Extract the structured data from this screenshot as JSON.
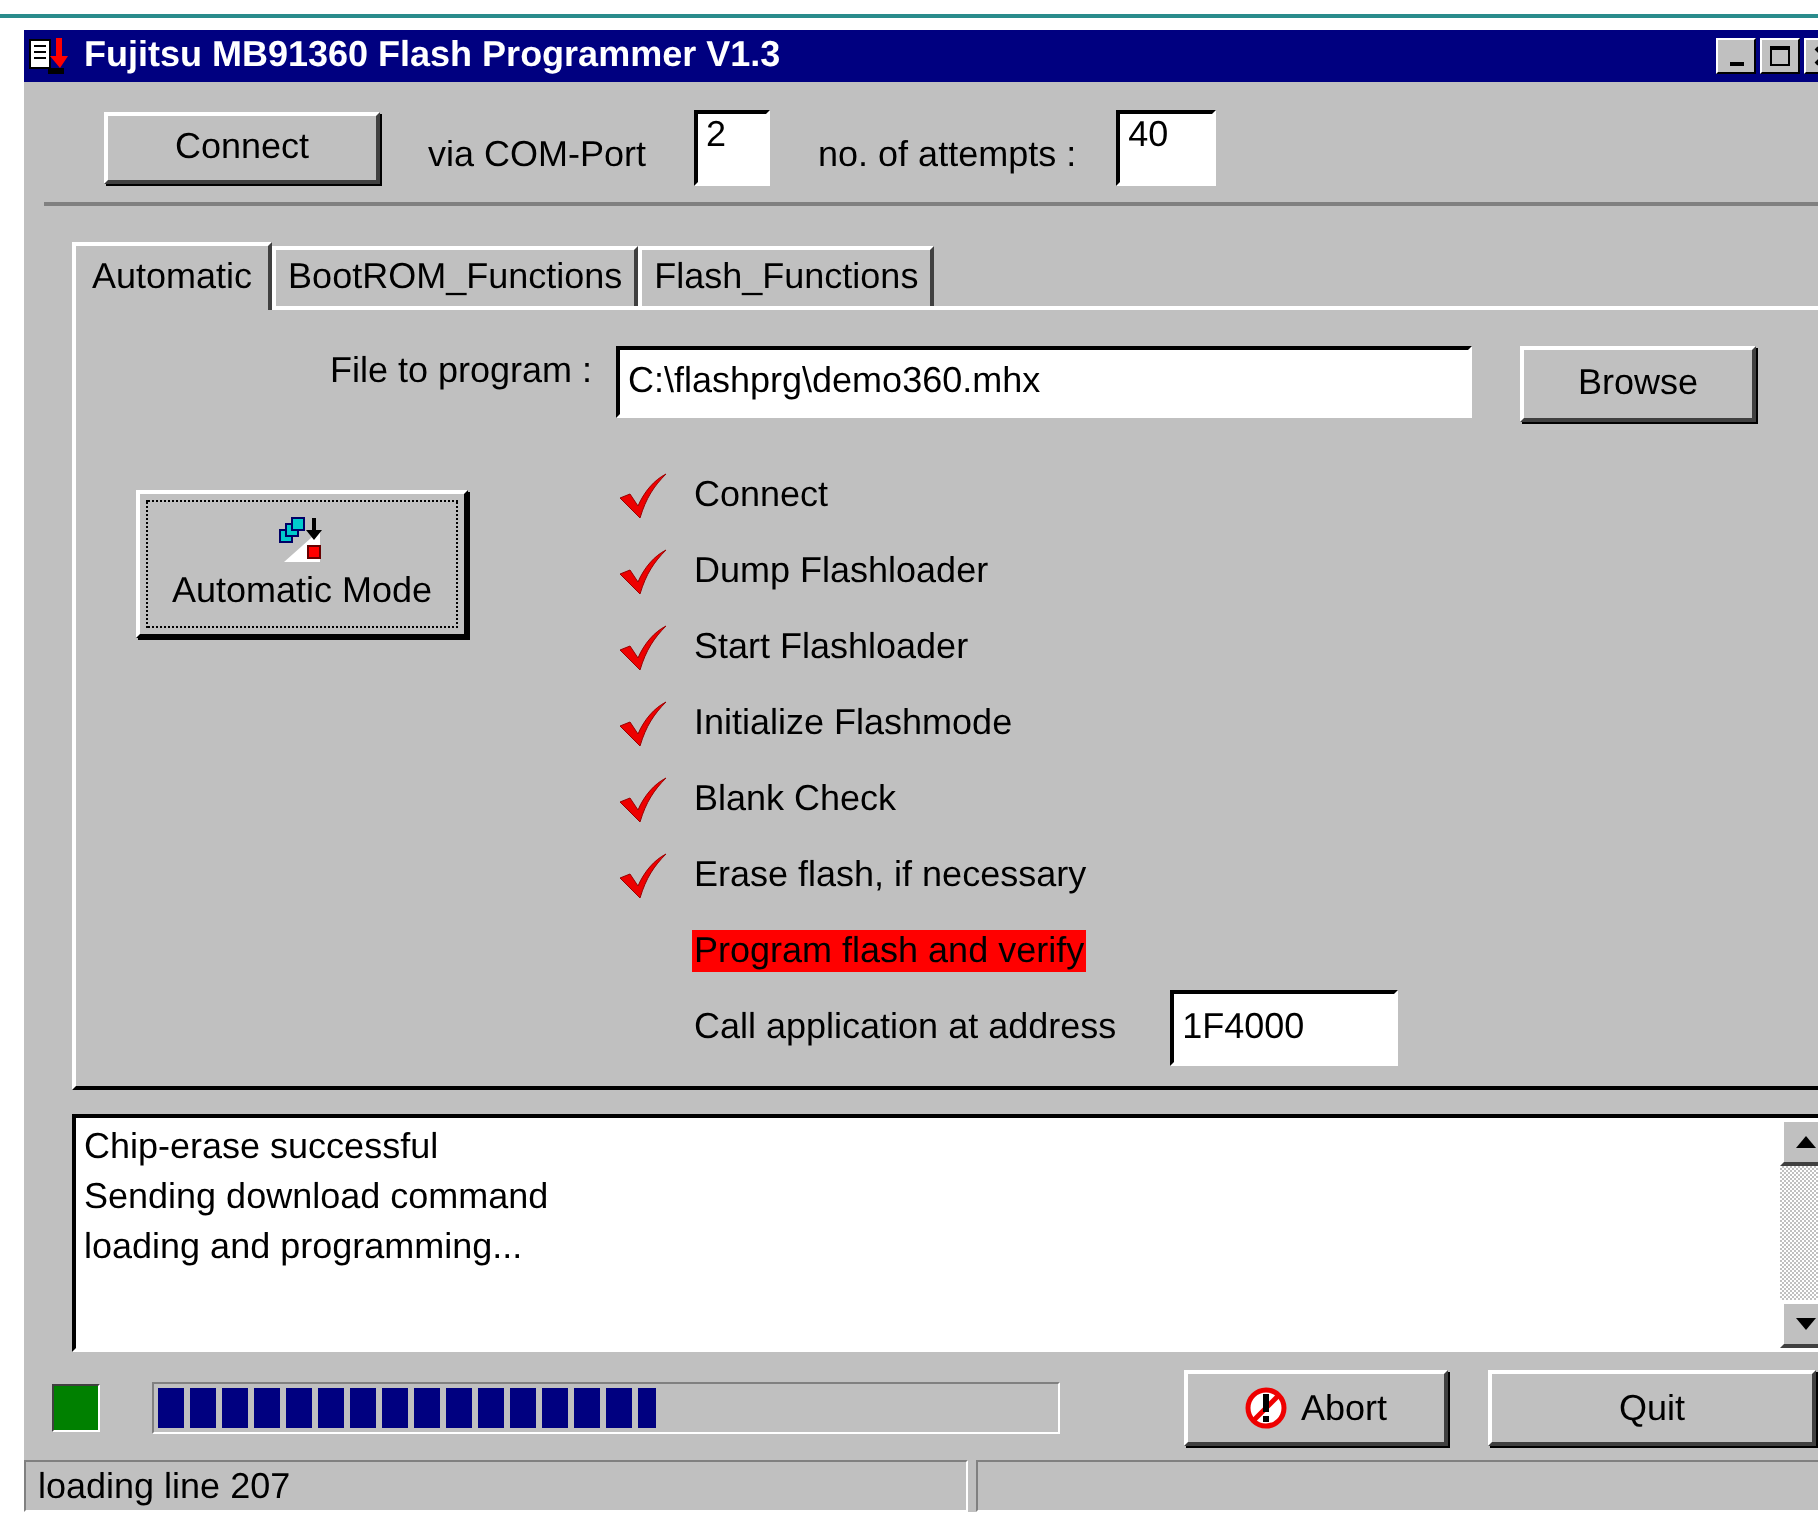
{
  "window": {
    "title": "Fujitsu MB91360 Flash Programmer V1.3"
  },
  "connection": {
    "button": "Connect",
    "port_label": "via COM-Port",
    "port": "2",
    "attempts_label": "no. of attempts :",
    "attempts": "40"
  },
  "tabs": [
    {
      "label": "Automatic",
      "selected": true
    },
    {
      "label": "BootROM_Functions",
      "selected": false
    },
    {
      "label": "Flash_Functions",
      "selected": false
    }
  ],
  "file": {
    "label": "File to program :",
    "value": "C:\\flashprg\\demo360.mhx",
    "button": "Browse"
  },
  "auto_button": "Automatic Mode",
  "steps": [
    {
      "kind": "step",
      "label": "Connect",
      "done": true,
      "current": false
    },
    {
      "kind": "step",
      "label": "Dump Flashloader",
      "done": true,
      "current": false
    },
    {
      "kind": "step",
      "label": "Start Flashloader",
      "done": true,
      "current": false
    },
    {
      "kind": "step",
      "label": "Initialize Flashmode",
      "done": true,
      "current": false
    },
    {
      "kind": "step",
      "label": "Blank Check",
      "done": true,
      "current": false
    },
    {
      "kind": "step",
      "label": "Erase flash, if necessary",
      "done": true,
      "current": false
    },
    {
      "kind": "step",
      "label": "Program flash and verify",
      "done": false,
      "current": true
    },
    {
      "kind": "address",
      "label": "Call application at address",
      "done": false,
      "current": false,
      "value": "1F4000"
    }
  ],
  "log": [
    "Chip-erase successful",
    "Sending download command",
    "loading and programming..."
  ],
  "progress": {
    "level": 0.555
  },
  "buttons": [
    {
      "kind": "abort",
      "label": "Abort"
    },
    {
      "kind": "plain",
      "label": "Quit"
    }
  ],
  "status_bar": [
    "loading line 207"
  ]
}
